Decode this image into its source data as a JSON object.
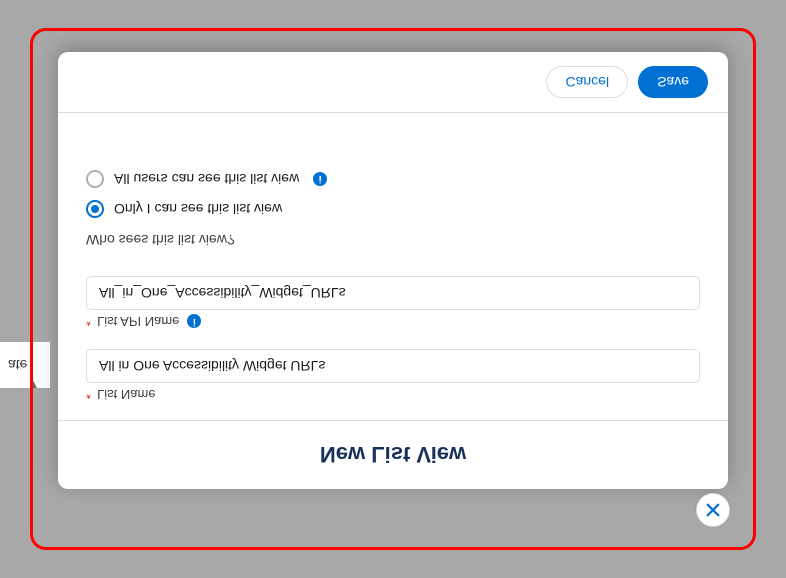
{
  "background": {
    "partial_text": "ate"
  },
  "modal": {
    "title": "New List View",
    "fields": {
      "list_name": {
        "label": "List Name",
        "value": "All in One Accessibility Widget URLs"
      },
      "api_name": {
        "label": "List API Name",
        "value": "All_in_One_Accessibility_Widget_URLs"
      }
    },
    "visibility": {
      "section_label": "Who sees this list view?",
      "options": [
        {
          "label": "Only I can see this list view",
          "selected": true,
          "has_info": false
        },
        {
          "label": "All users can see this list view",
          "selected": false,
          "has_info": true
        }
      ]
    },
    "buttons": {
      "cancel": "Cancel",
      "save": "Save"
    }
  }
}
